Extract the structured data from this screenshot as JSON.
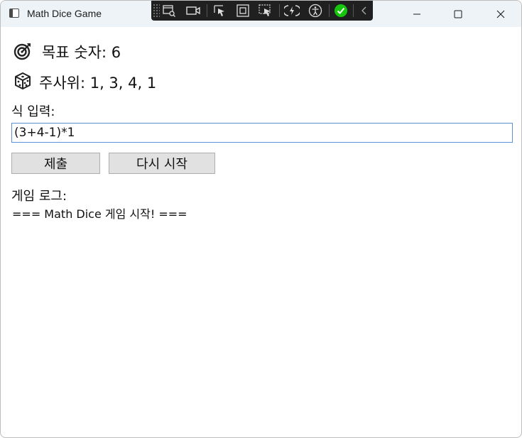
{
  "window": {
    "title": "Math Dice Game",
    "controls": [
      "minimize-icon",
      "maximize-icon",
      "close-icon"
    ]
  },
  "devtools": {
    "tools": [
      "live-visual-tree-icon",
      "video-icon",
      "select-element-icon",
      "display-layout-adorners-icon",
      "track-focus-icon",
      "hot-reload-icon",
      "accessibility-icon",
      "binding-check-icon",
      "collapse-chevron-icon"
    ],
    "status_color": "#16c60c"
  },
  "game": {
    "target_label": "목표 숫자: 6",
    "dice_label": "주사위: 1, 3, 4, 1",
    "input_label": "식 입력:",
    "expression_value": "(3+4-1)*1",
    "submit_label": "제출",
    "restart_label": "다시 시작",
    "log_label": "게임 로그:",
    "log_lines": [
      "=== Math Dice 게임 시작! ==="
    ]
  },
  "colors": {
    "titlebar": "#eef3f8",
    "input_border": "#5b8fd8",
    "button_bg": "#e1e1e1"
  }
}
